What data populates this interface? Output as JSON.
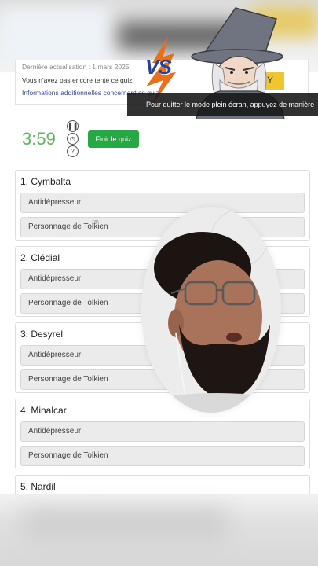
{
  "overlay": {
    "vs_label": "VS",
    "toast": "Pour quitter le mode plein écran, appuyez de manière"
  },
  "header_card": {
    "line1": "Dernière actualisation : 1 mars 2025",
    "line2": "Vous n'avez pas encore tenté ce quiz.",
    "link": "Informations additionnelles concernant ce quiz",
    "yellow_btn": "Y"
  },
  "controls": {
    "timer": "3:59",
    "pause_icon": "pause-icon",
    "clock_icon": "clock-icon",
    "help_icon": "help-icon",
    "finish_label": "Finir le quiz"
  },
  "questions": [
    {
      "title": "1. Cymbalta",
      "options": [
        "Antidépresseur",
        "Personnage de Tolkien"
      ]
    },
    {
      "title": "2. Clédial",
      "options": [
        "Antidépresseur",
        "Personnage de Tolkien"
      ]
    },
    {
      "title": "3. Desyrel",
      "options": [
        "Antidépresseur",
        "Personnage de Tolkien"
      ]
    },
    {
      "title": "4. Minalcar",
      "options": [
        "Antidépresseur",
        "Personnage de Tolkien"
      ]
    },
    {
      "title": "5. Nardil",
      "options": []
    }
  ],
  "colors": {
    "timer": "#5cb85c",
    "finish": "#28a745",
    "link": "#3949ab",
    "vs": "#27409b",
    "lightning": "#e8701a"
  }
}
